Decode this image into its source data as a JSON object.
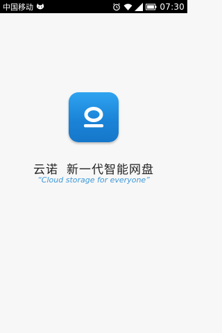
{
  "status_bar": {
    "carrier": "中国移动",
    "time": "07:30",
    "icons": [
      "cat-icon",
      "alarm-icon",
      "wifi-icon",
      "signal-icon",
      "battery-icon"
    ]
  },
  "splash": {
    "brand": "云诺",
    "tagline": "新一代智能网盘",
    "slogan": "“Cloud storage for everyone”",
    "icon_color": "#1f8be0"
  }
}
